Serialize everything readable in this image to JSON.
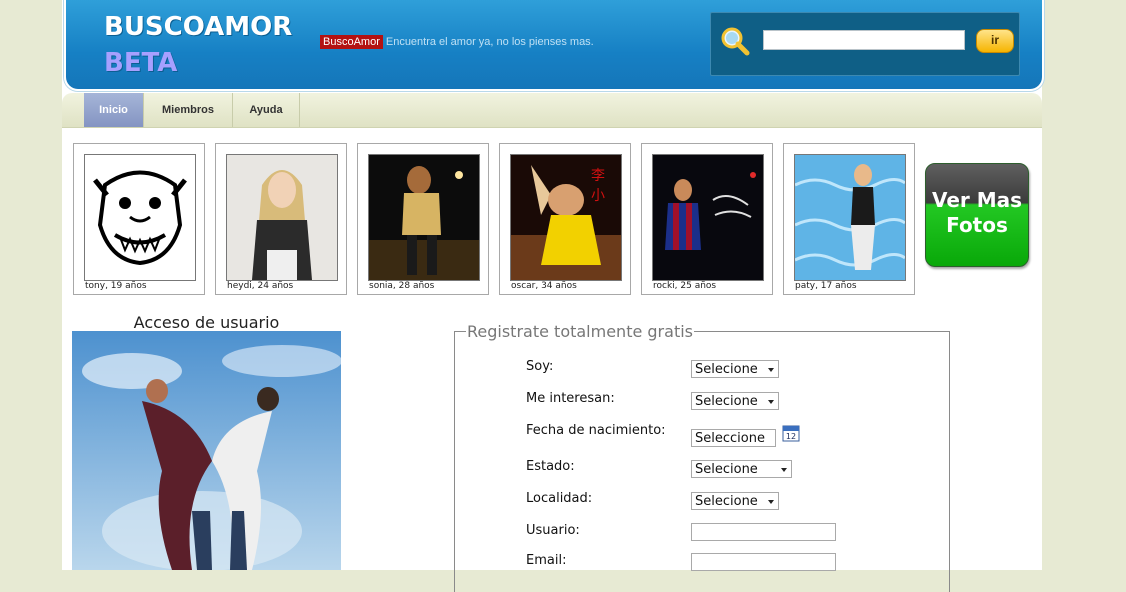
{
  "header": {
    "logo_line1": "BUSCOAMOR",
    "logo_line2": "BETA",
    "tagline_brand": "BuscoAmor",
    "tagline_text": "Encuentra el amor ya, no los pienses mas.",
    "search": {
      "value": "",
      "button_label": "ir"
    }
  },
  "nav": {
    "items": [
      {
        "label": "Inicio",
        "active": true
      },
      {
        "label": "Miembros",
        "active": false
      },
      {
        "label": "Ayuda",
        "active": false
      }
    ]
  },
  "photos": [
    {
      "caption": "tony, 19 años"
    },
    {
      "caption": "heydi, 24 años"
    },
    {
      "caption": "sonia, 28 años"
    },
    {
      "caption": "oscar, 34 años"
    },
    {
      "caption": "rocki, 25 años"
    },
    {
      "caption": "paty, 17 años"
    }
  ],
  "more_photos_label": "Ver Mas Fotos",
  "login": {
    "title": "Acceso de usuario"
  },
  "register": {
    "legend": "Registrate totalmente gratis",
    "fields": {
      "soy": {
        "label": "Soy:",
        "value": "Selecione"
      },
      "me_interesan": {
        "label": "Me interesan:",
        "value": "Selecione"
      },
      "fecha": {
        "label": "Fecha de nacimiento:",
        "value": "Seleccione"
      },
      "estado": {
        "label": "Estado:",
        "value": "Selecione"
      },
      "localidad": {
        "label": "Localidad:",
        "value": "Selecione"
      },
      "usuario": {
        "label": "Usuario:",
        "value": ""
      },
      "email": {
        "label": "Email:",
        "value": ""
      }
    }
  },
  "colors": {
    "header_blue": "#1680c4",
    "nav_active": "#8494c2",
    "brand_red": "#b31212",
    "button_green": "#09a809"
  }
}
